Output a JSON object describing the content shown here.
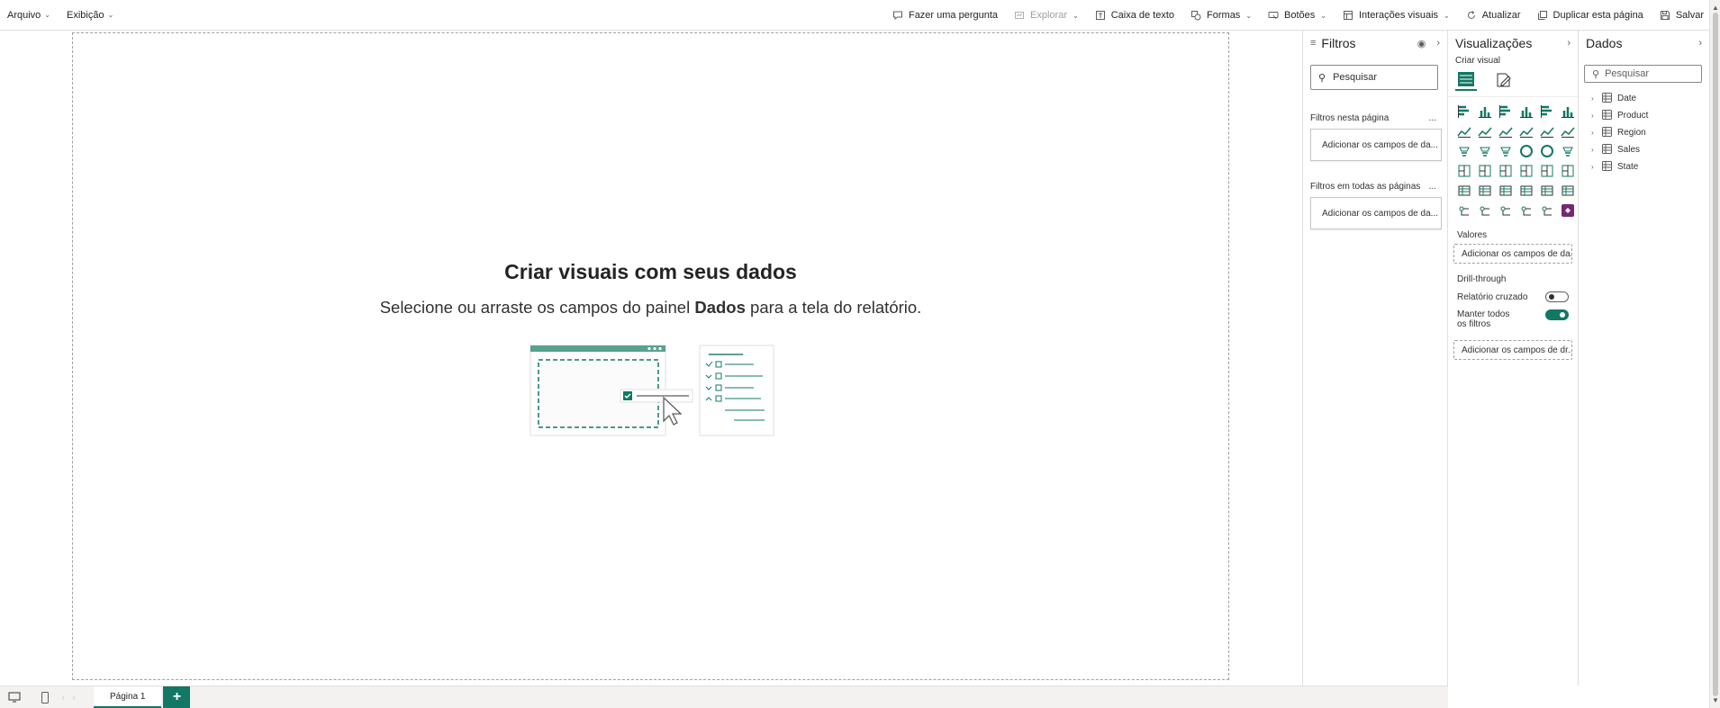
{
  "menu": [
    {
      "label": "Arquivo"
    },
    {
      "label": "Exibição"
    }
  ],
  "toolbar": {
    "items": [
      {
        "label": "Fazer uma pergunta",
        "icon": "chat-bubble-icon"
      },
      {
        "label": "Explorar",
        "icon": "explore-icon",
        "disabled": true
      },
      {
        "label": "Caixa de texto",
        "icon": "text-box-icon"
      },
      {
        "label": "Formas",
        "icon": "shapes-icon"
      },
      {
        "label": "Botões",
        "icon": "buttons-icon"
      },
      {
        "label": "Interações visuais",
        "icon": "visual-interactions-icon"
      },
      {
        "label": "Atualizar",
        "icon": "refresh-icon"
      },
      {
        "label": "Duplicar esta página",
        "icon": "duplicate-icon"
      },
      {
        "label": "Salvar",
        "icon": "save-icon"
      }
    ]
  },
  "canvas": {
    "empty_title": "Criar visuais com seus dados",
    "empty_subtitle_pre": "Selecione ou arraste os campos do painel ",
    "empty_subtitle_bold": "Dados",
    "empty_subtitle_post": " para a tela do relatório."
  },
  "filters": {
    "title": "Filtros",
    "search_placeholder": "Pesquisar",
    "on_page_label": "Filtros nesta página",
    "on_page_drop": "Adicionar os campos de da...",
    "all_pages_label": "Filtros em todas as páginas",
    "all_pages_drop": "Adicionar os campos de da...",
    "more": "..."
  },
  "visualizations": {
    "title": "Visualizações",
    "create_label": "Criar visual",
    "values_label": "Valores",
    "values_drop": "Adicionar os campos de da...",
    "drillthrough_label": "Drill-through",
    "cross_report_label": "Relatório cruzado",
    "cross_report_on": false,
    "keep_filters_label": "Manter todos os filtros",
    "keep_filters_on": true,
    "drill_drop": "Adicionar os campos de dr..."
  },
  "data_pane": {
    "title": "Dados",
    "search_placeholder": "Pesquisar",
    "tables": [
      "Date",
      "Product",
      "Region",
      "Sales",
      "State"
    ]
  },
  "pages": {
    "tabs": [
      "Página 1"
    ],
    "add_label": "+"
  },
  "colors": {
    "accent": "#117865"
  }
}
